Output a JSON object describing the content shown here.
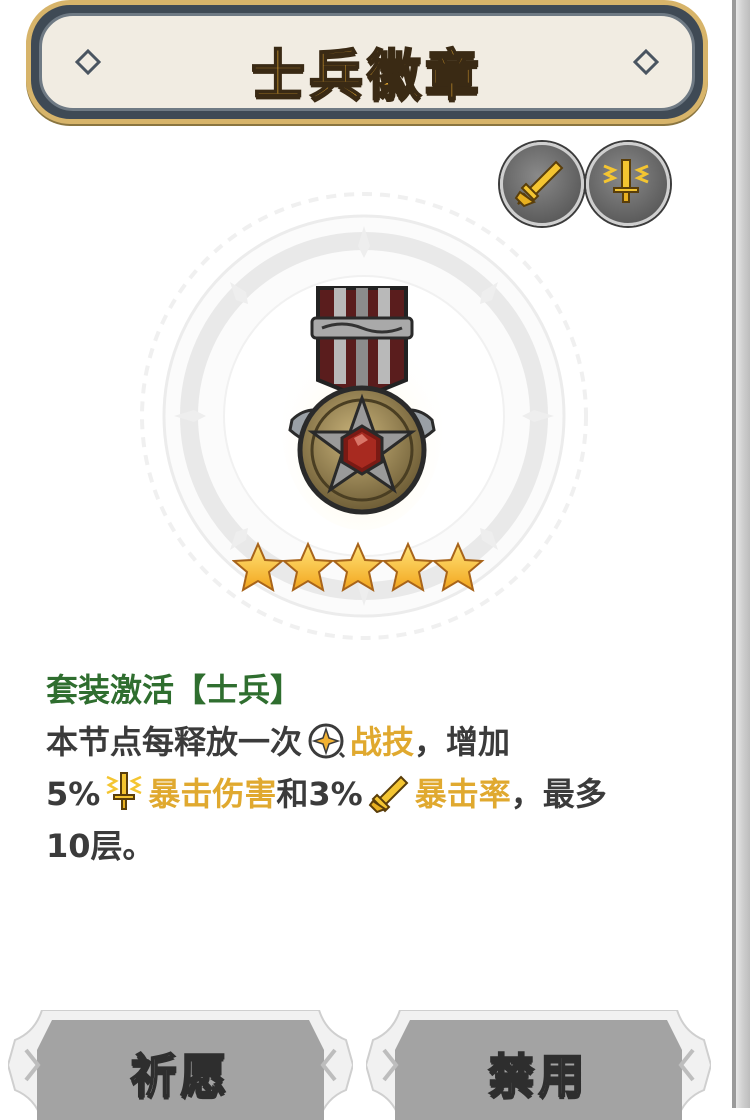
{
  "title": "士兵徽章",
  "rarity_stars": 5,
  "tag_icons": [
    "crit-rate-sword-icon",
    "crit-damage-sword-icon"
  ],
  "description": {
    "set_label": "套装激活【士兵】",
    "line1_prefix": "本节点每释放一次",
    "skill_icon": "skill-icon",
    "skill_name": "战技",
    "line1_suffix": "，增加",
    "crit_damage_value": "5%",
    "crit_damage_icon": "crit-damage-sword-icon",
    "crit_damage_name": "暴击伤害",
    "conjunction": "和",
    "crit_rate_value": "3%",
    "crit_rate_icon": "crit-rate-sword-icon",
    "crit_rate_name": "暴击率",
    "max_text": "，最多",
    "stack_text": "10层。"
  },
  "buttons": {
    "pray_label": "祈愿",
    "ban_label": "禁用"
  },
  "colors": {
    "title_gold": "#f2b233",
    "highlight_gold": "#e0a92f",
    "set_green": "#2f6e2f",
    "button_gray": "#a3a3a3"
  }
}
